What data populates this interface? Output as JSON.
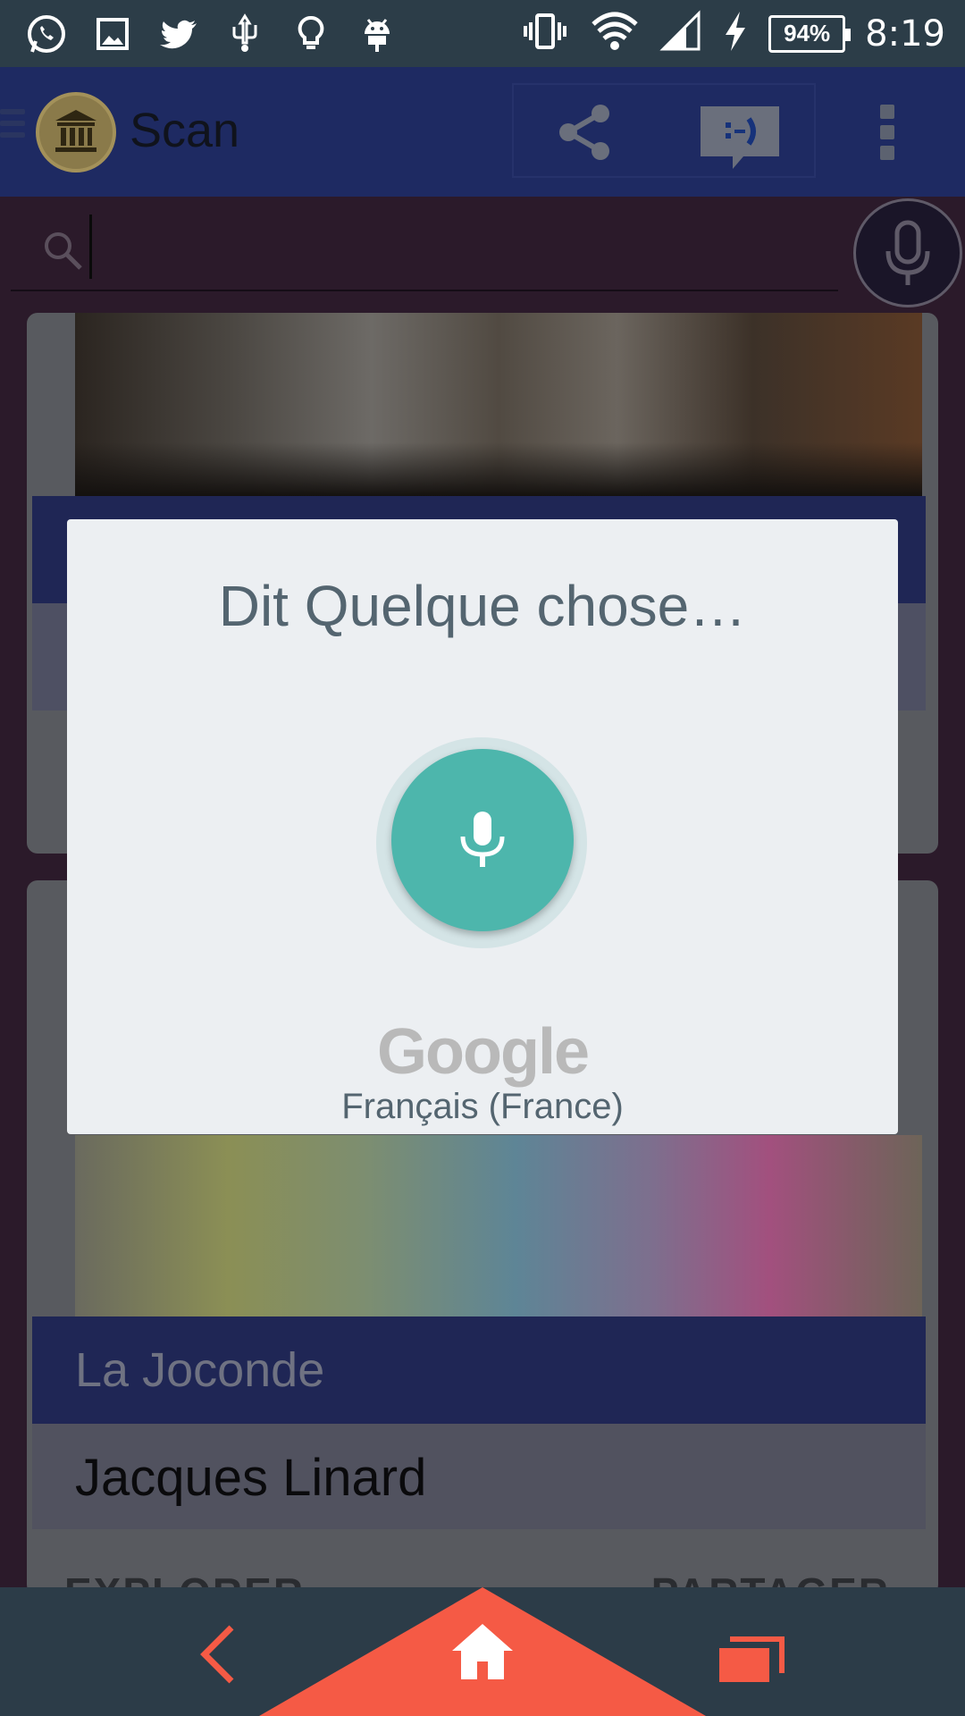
{
  "status_bar": {
    "battery_percent": "94%",
    "time": "8:19",
    "icons": [
      "whatsapp-icon",
      "gallery-icon",
      "twitter-icon",
      "usb-icon",
      "lightbulb-icon",
      "android-icon",
      "vibrate-icon",
      "wifi-icon",
      "signal-icon",
      "charging-icon"
    ]
  },
  "app_bar": {
    "title": "Scan",
    "icons": [
      "menu-icon",
      "museum-logo-icon",
      "share-icon",
      "chat-icon",
      "overflow-icon"
    ]
  },
  "search": {
    "value": "",
    "icons": [
      "search-icon",
      "mic-icon"
    ]
  },
  "cards": [
    {
      "title": "",
      "subtitle": ""
    },
    {
      "title": "La Joconde",
      "subtitle": "Jacques Linard",
      "explore_label": "EXPLORER",
      "share_label": "PARTAGER"
    }
  ],
  "voice_dialog": {
    "prompt": "Dit Quelque chose…",
    "brand": "Google",
    "language": "Français (France)",
    "mic_color": "#4db6ac"
  },
  "nav": {
    "accent_color": "#f55a45",
    "icons": [
      "back-icon",
      "home-icon",
      "recent-apps-icon"
    ]
  }
}
